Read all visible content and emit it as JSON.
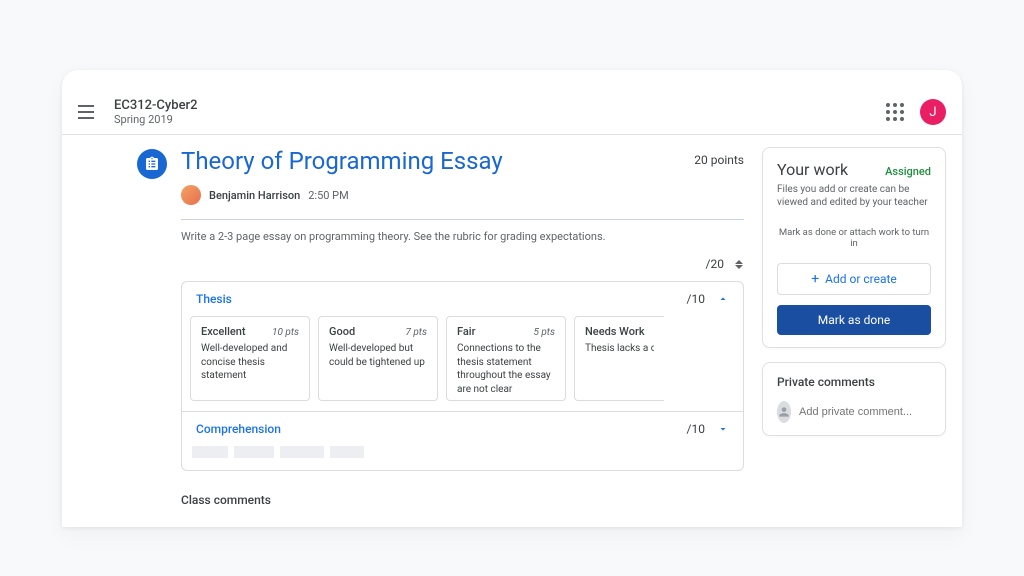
{
  "header": {
    "class_name": "EC312-Cyber2",
    "term": "Spring 2019",
    "avatar_letter": "J"
  },
  "assignment": {
    "title": "Theory of Programming Essay",
    "points_label": "20 points",
    "teacher": "Benjamin Harrison",
    "timestamp": "2:50 PM",
    "description": "Write a 2-3 page essay on programming theory. See the rubric for grading expectations.",
    "total_score": "/20"
  },
  "rubric": {
    "sections": [
      {
        "name": "Thesis",
        "points": "/10",
        "expanded": true,
        "levels": [
          {
            "title": "Excellent",
            "pts": "10 pts",
            "desc": "Well-developed and concise thesis statement"
          },
          {
            "title": "Good",
            "pts": "7 pts",
            "desc": "Well-developed but could be tightened up"
          },
          {
            "title": "Fair",
            "pts": "5 pts",
            "desc": "Connections to the thesis statement throughout the essay are not clear"
          },
          {
            "title": "Needs Work",
            "pts": "",
            "desc": "Thesis lacks a clear point of view and connection to the rest of the essay"
          }
        ]
      },
      {
        "name": "Comprehension",
        "points": "/10",
        "expanded": false
      }
    ]
  },
  "class_comments_label": "Class comments",
  "your_work": {
    "title": "Your work",
    "status": "Assigned",
    "sub": "Files you add or create can be viewed and edited by your teacher",
    "hint": "Mark as done or attach work to turn in",
    "add_label": "Add or create",
    "done_label": "Mark as done"
  },
  "private_comments": {
    "title": "Private comments",
    "placeholder": "Add private comment..."
  }
}
